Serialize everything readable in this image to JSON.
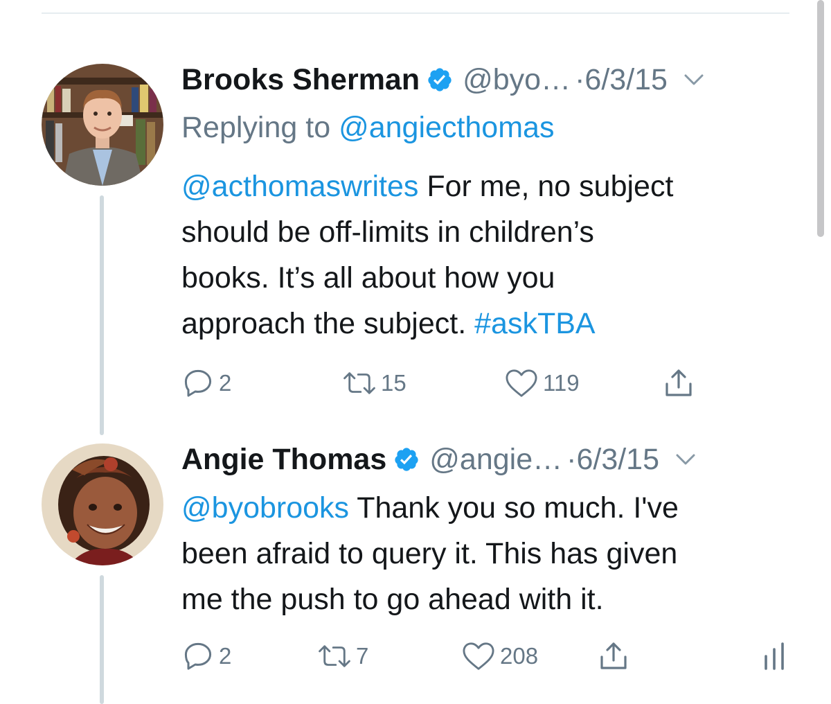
{
  "tweets": [
    {
      "name": "Brooks Sherman",
      "handle": "@byo…",
      "date": "·6/3/15",
      "replying_prefix": "Replying to ",
      "replying_to": "@angiecthomas",
      "mention": "@acthomaswrites",
      "text_lines": [
        " For me, no subject",
        "should be off-limits in children’s",
        "books. It’s all about how you",
        "approach the subject. "
      ],
      "hashtag": "#askTBA",
      "replies": "2",
      "retweets": "15",
      "likes": "119",
      "avatar_icon": "man-portrait-bookshelf"
    },
    {
      "name": "Angie Thomas",
      "handle": "@angie…",
      "date": "·6/3/15",
      "mention": "@byobrooks",
      "text_lines": [
        " Thank you so much. I've",
        "been afraid to query it. This has given",
        "me the push to go ahead with it."
      ],
      "replies": "2",
      "retweets": "7",
      "likes": "208",
      "avatar_icon": "girl-childhood-portrait"
    }
  ],
  "colors": {
    "link": "#1b95e0",
    "muted": "#657786",
    "text": "#14171a",
    "verified": "#1da1f2",
    "thread_line": "#cfd9de"
  }
}
